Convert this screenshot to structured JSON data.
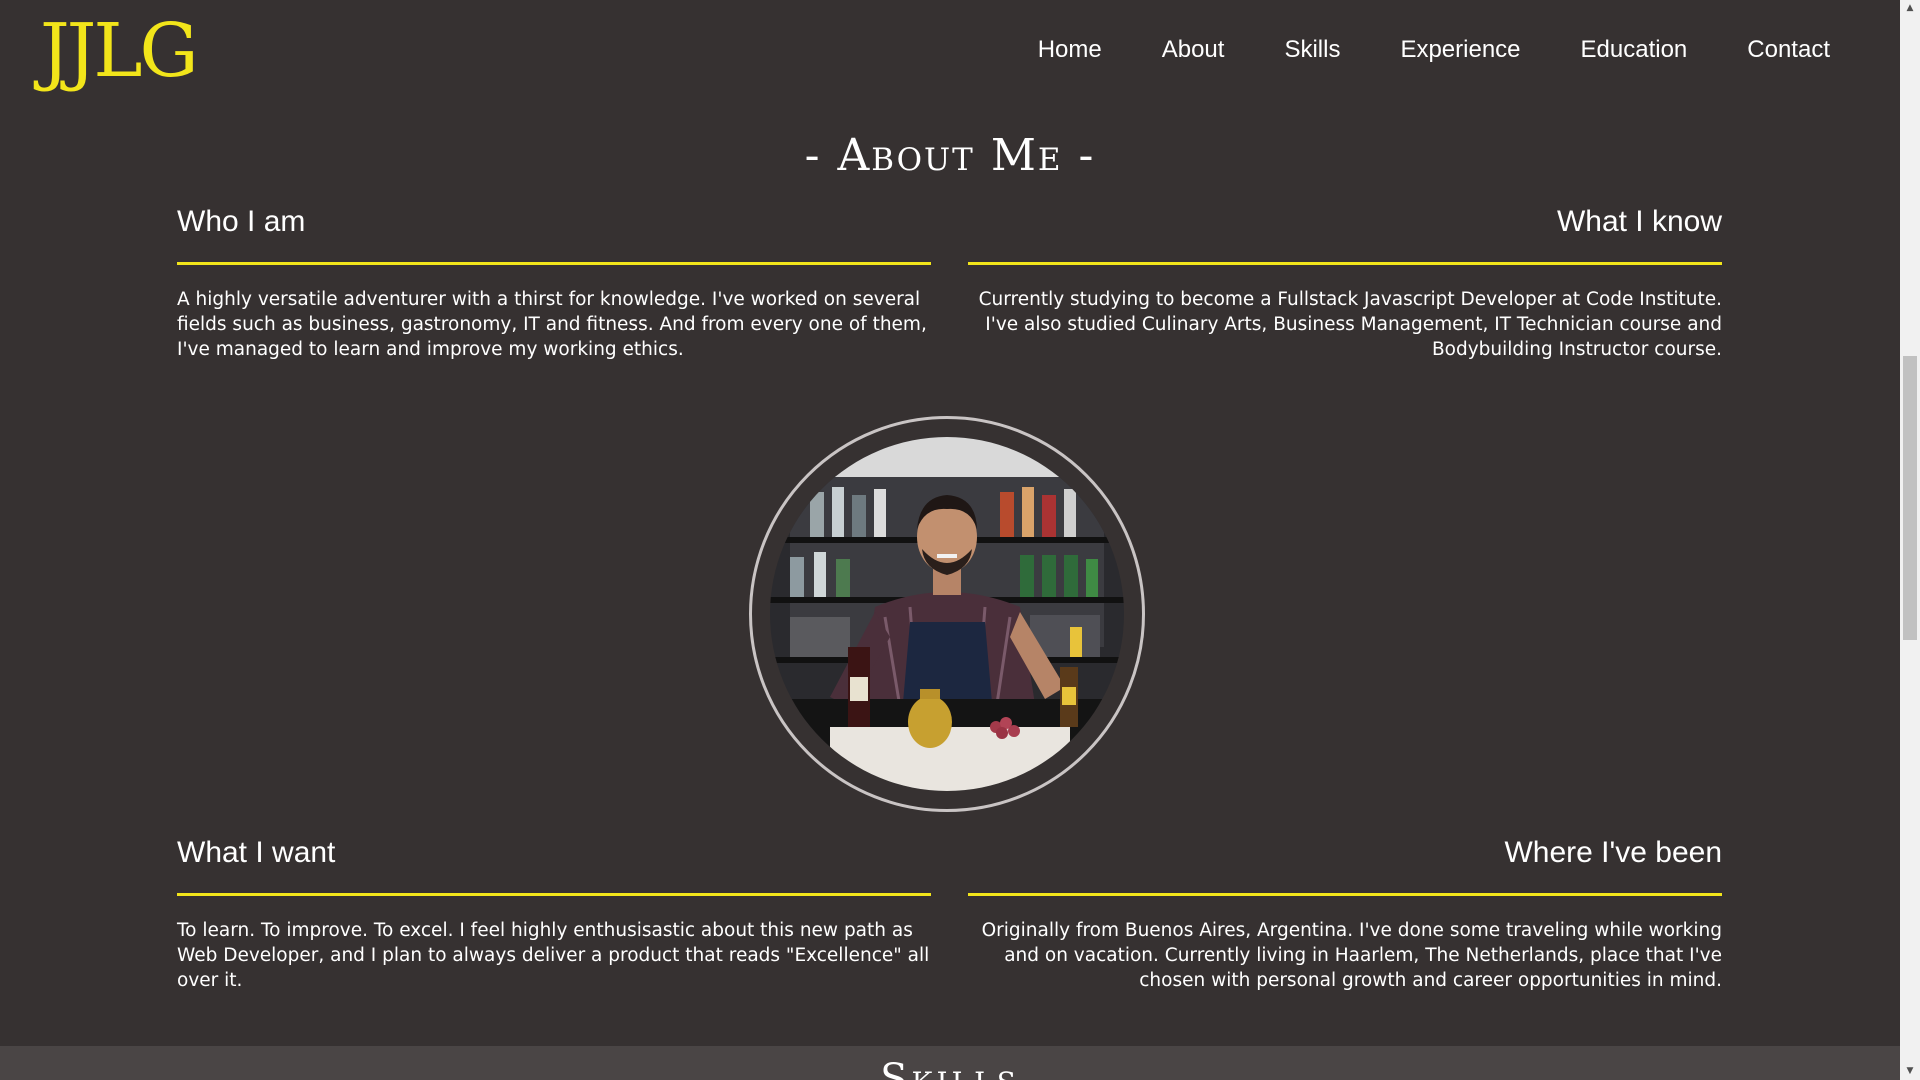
{
  "header": {
    "logo": "JJLG",
    "nav": [
      "Home",
      "About",
      "Skills",
      "Experience",
      "Education",
      "Contact"
    ]
  },
  "about": {
    "title": "- About Me -",
    "who": {
      "heading": "Who I am",
      "text": "A highly versatile adventurer with a thirst for knowledge. I've worked on several fields such as business, gastronomy, IT and fitness. And from every one of them, I've managed to learn and improve my working ethics."
    },
    "know": {
      "heading": "What I know",
      "text": "Currently studying to become a Fullstack Javascript Developer at Code Institute. I've also studied Culinary Arts, Business Management, IT Technician course and Bodybuilding Instructor course."
    },
    "want": {
      "heading": "What I want",
      "text": "To learn. To improve. To excel. I feel highly enthusisastic about this new path as Web Developer, and I plan to always deliver a product that reads \"Excellence\" all over it."
    },
    "been": {
      "heading": "Where I've been",
      "text": "Originally from Buenos Aires, Argentina. I've done some traveling while working and on vacation. Currently living in Haarlem, The Netherlands, place that I've chosen with personal growth and career opportunities in mind."
    }
  },
  "next_section": {
    "title": "Skills"
  },
  "colors": {
    "background": "#363131",
    "accent": "#f2e51a",
    "text": "#ffffff"
  },
  "icons": {
    "scroll_up": "scroll-up-arrow-icon",
    "scroll_down": "scroll-down-arrow-icon"
  }
}
